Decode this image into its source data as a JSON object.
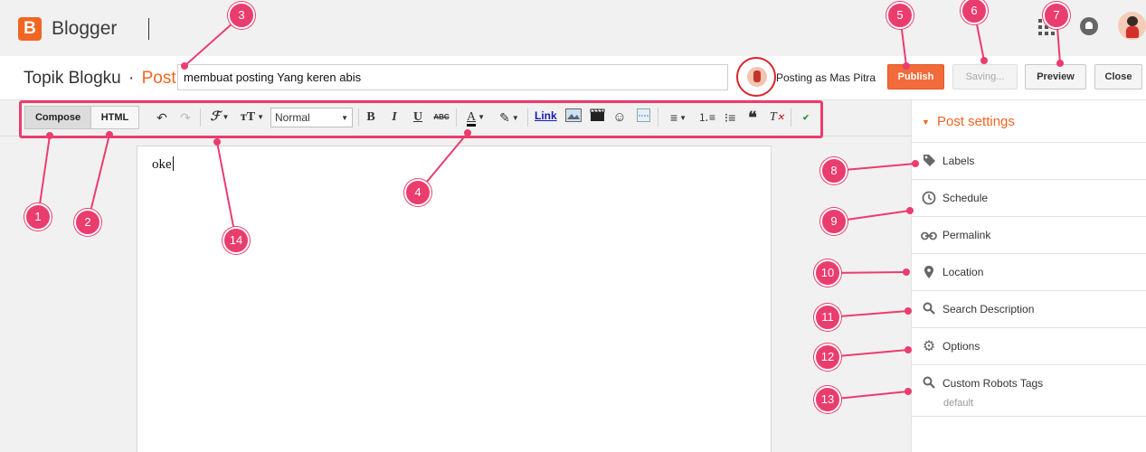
{
  "app": {
    "brand": "Blogger",
    "logo_letter": "B"
  },
  "header": {
    "blog_name": "Topik Blogku",
    "separator": "·",
    "section": "Post",
    "title_value": "membuat posting Yang keren abis",
    "posting_as_label": "Posting as",
    "posting_as_user": "Mas Pitra",
    "publish_label": "Publish",
    "saving_label": "Saving...",
    "preview_label": "Preview",
    "close_label": "Close"
  },
  "toolbar": {
    "compose_label": "Compose",
    "html_label": "HTML",
    "font_size_value": "Normal",
    "link_label": "Link",
    "icons": [
      "undo-icon",
      "redo-icon",
      "font-family-icon",
      "font-size-icon",
      "bold-icon",
      "italic-icon",
      "underline-icon",
      "strikethrough-icon",
      "text-color-icon",
      "highlight-icon",
      "link-icon",
      "image-icon",
      "video-icon",
      "emoji-icon",
      "jump-break-icon",
      "align-icon",
      "numbered-list-icon",
      "bullet-list-icon",
      "quote-icon",
      "clear-format-icon",
      "spellcheck-icon"
    ]
  },
  "editor": {
    "content": "oke"
  },
  "sidebar": {
    "title": "Post settings",
    "items": [
      {
        "label": "Labels",
        "icon": "tag-icon"
      },
      {
        "label": "Schedule",
        "icon": "clock-icon"
      },
      {
        "label": "Permalink",
        "icon": "link-icon"
      },
      {
        "label": "Location",
        "icon": "pin-icon"
      },
      {
        "label": "Search Description",
        "icon": "search-icon"
      },
      {
        "label": "Options",
        "icon": "gear-icon"
      },
      {
        "label": "Custom Robots Tags",
        "icon": "search-icon",
        "sub": "default"
      }
    ]
  },
  "annotations": [
    "1",
    "2",
    "3",
    "4",
    "5",
    "6",
    "7",
    "8",
    "9",
    "10",
    "11",
    "12",
    "13",
    "14"
  ],
  "colors": {
    "accent": "#f26522",
    "publish": "#f26b3a",
    "annotation": "#ea3d6e"
  }
}
